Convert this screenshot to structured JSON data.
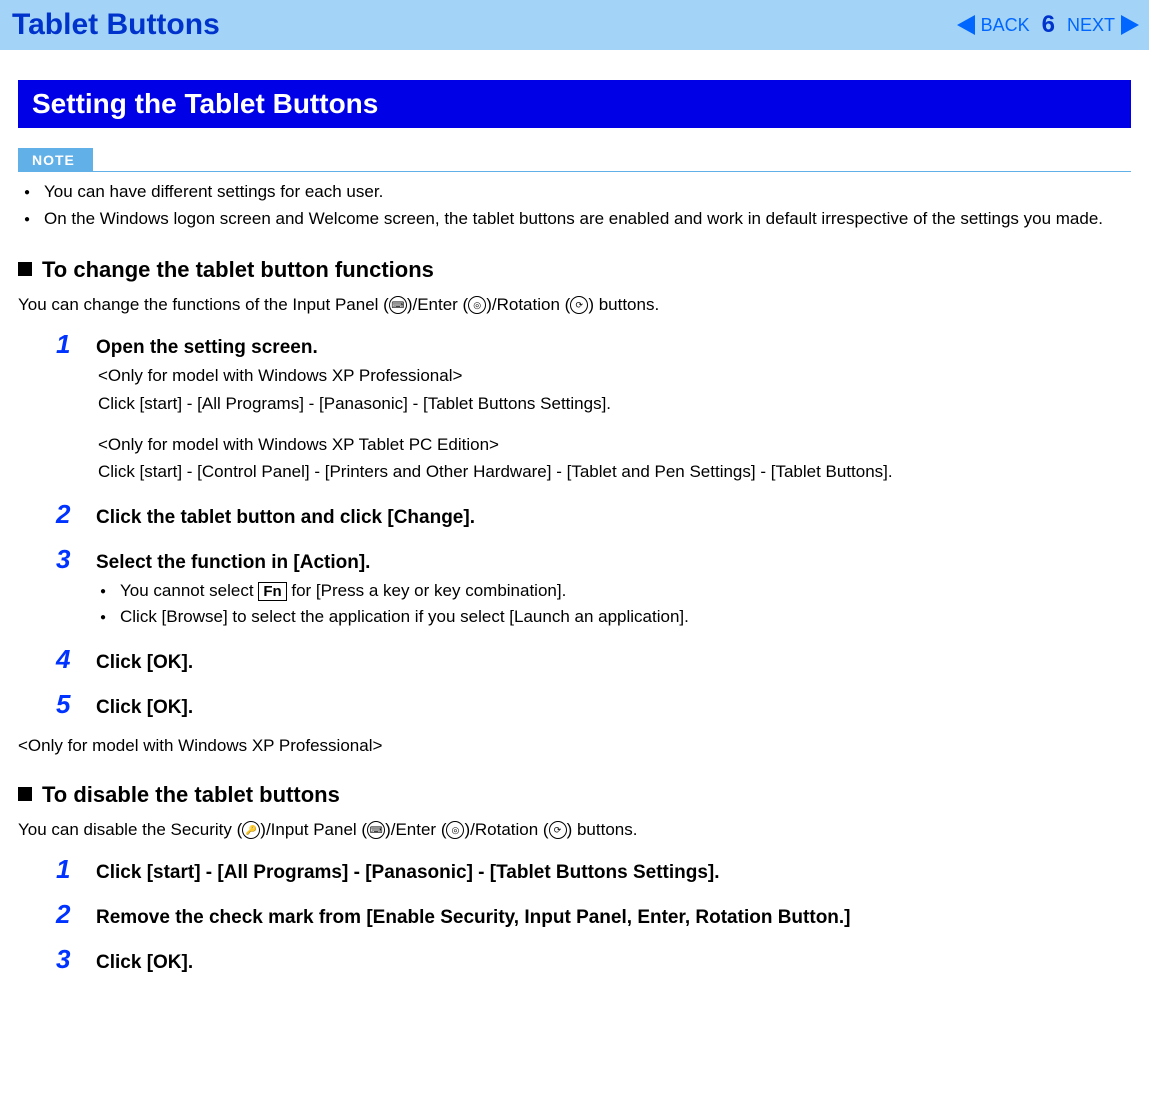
{
  "header": {
    "title": "Tablet Buttons",
    "back": "BACK",
    "next": "NEXT",
    "page": "6"
  },
  "section_banner": "Setting the Tablet Buttons",
  "note": {
    "label": "NOTE",
    "items": [
      "You can have different settings for each user.",
      "On the Windows logon screen and Welcome screen, the tablet buttons are enabled and work in default irrespective of the settings you made."
    ]
  },
  "change": {
    "heading": "To change the tablet button functions",
    "intro_pre": "You can change the functions of the Input Panel (",
    "intro_mid1": ")/Enter (",
    "intro_mid2": ")/Rotation (",
    "intro_post": ") buttons.",
    "steps": [
      {
        "num": "1",
        "title": "Open the setting screen.",
        "body": [
          "<Only for model with Windows XP Professional>",
          "Click [start] - [All Programs] - [Panasonic] - [Tablet Buttons Settings].",
          "",
          "<Only for model with Windows XP Tablet PC Edition>",
          "Click [start] - [Control Panel] - [Printers and Other Hardware] - [Tablet and Pen Settings] - [Tablet Buttons]."
        ]
      },
      {
        "num": "2",
        "title": "Click the tablet button and click [Change]."
      },
      {
        "num": "3",
        "title": "Select the function in [Action].",
        "bullets_pre": "You cannot select ",
        "bullets_fn": "Fn",
        "bullets_post": " for [Press a key or key combination].",
        "bullet2": "Click [Browse] to select the application if you select [Launch an application]."
      },
      {
        "num": "4",
        "title": "Click [OK]."
      },
      {
        "num": "5",
        "title": "Click [OK]."
      }
    ]
  },
  "only_xp_pro": "<Only for model with Windows XP Professional>",
  "disable": {
    "heading": "To disable the tablet buttons",
    "intro_pre": "You can disable the Security (",
    "intro_mid1": ")/Input Panel (",
    "intro_mid2": ")/Enter (",
    "intro_mid3": ")/Rotation (",
    "intro_post": ") buttons.",
    "steps": [
      {
        "num": "1",
        "title": "Click [start] - [All Programs] - [Panasonic] - [Tablet Buttons Settings]."
      },
      {
        "num": "2",
        "title": "Remove the check mark from [Enable Security, Input Panel, Enter, Rotation Button.]"
      },
      {
        "num": "3",
        "title": "Click [OK]."
      }
    ]
  }
}
